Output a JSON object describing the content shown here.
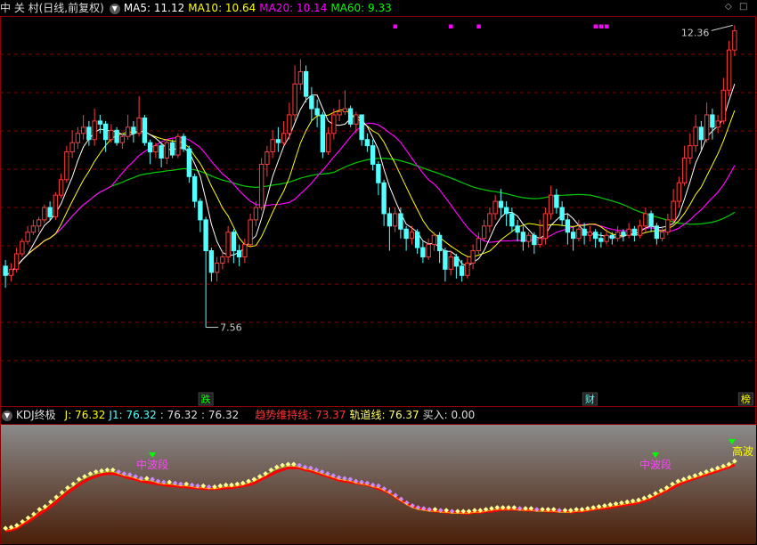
{
  "header": {
    "stock_title": "中 关 村(日线,前复权)",
    "ma": [
      {
        "label": "MA5: 11.12",
        "color": "#ffffff"
      },
      {
        "label": "MA10: 10.64",
        "color": "#ffff00"
      },
      {
        "label": "MA20: 10.14",
        "color": "#ff00ff"
      },
      {
        "label": "MA60: 9.33",
        "color": "#00ff00"
      }
    ]
  },
  "kdj_header": {
    "name": "KDJ终极",
    "j": "J: 76.32",
    "j1": "J1: 76.32",
    "v3": ": 76.32",
    "v4": ": 76.32",
    "trend": "趋势维持线: 73.37",
    "track": "轨道线: 76.37",
    "buy": "买入: 0.00"
  },
  "icons": [
    "dropdown-icon",
    "diamond-icon",
    "square-icon"
  ],
  "colors": {
    "up": "#ff3b3b",
    "down": "#54ffff",
    "ma5": "#ffffff",
    "ma10": "#ffff00",
    "ma20": "#ff00ff",
    "ma60": "#00cc00",
    "grid": "#8b0000"
  },
  "chart_data": [
    {
      "type": "candlestick",
      "title": "中关村 日线 前复权",
      "ylim": [
        6.4,
        12.6
      ],
      "annotations": {
        "high": "12.36",
        "low": "7.56",
        "markers": [
          "跌",
          "财",
          "榜"
        ]
      },
      "candles": [
        [
          8.55,
          8.4,
          8.65,
          8.2
        ],
        [
          8.4,
          8.5,
          8.6,
          8.3
        ],
        [
          8.5,
          8.75,
          8.85,
          8.45
        ],
        [
          8.75,
          8.95,
          9.0,
          8.7
        ],
        [
          8.95,
          9.1,
          9.2,
          8.9
        ],
        [
          9.1,
          9.2,
          9.3,
          9.05
        ],
        [
          9.2,
          9.3,
          9.35,
          9.1
        ],
        [
          9.3,
          9.5,
          9.55,
          9.25
        ],
        [
          9.5,
          9.35,
          9.6,
          9.3
        ],
        [
          9.35,
          9.7,
          9.75,
          9.3
        ],
        [
          9.7,
          9.95,
          10.05,
          9.65
        ],
        [
          9.95,
          10.4,
          10.5,
          9.9
        ],
        [
          10.4,
          10.55,
          10.75,
          10.3
        ],
        [
          10.55,
          10.7,
          10.8,
          10.45
        ],
        [
          10.7,
          10.8,
          11.0,
          10.6
        ],
        [
          10.8,
          10.6,
          10.9,
          10.5
        ],
        [
          10.6,
          10.9,
          11.1,
          10.5
        ],
        [
          10.9,
          10.85,
          11.0,
          10.7
        ],
        [
          10.85,
          10.6,
          10.9,
          10.4
        ],
        [
          10.6,
          10.75,
          10.85,
          10.55
        ],
        [
          10.75,
          10.55,
          10.8,
          10.5
        ],
        [
          10.55,
          10.65,
          10.7,
          10.45
        ],
        [
          10.65,
          10.8,
          11.0,
          10.6
        ],
        [
          10.8,
          10.7,
          10.9,
          10.55
        ],
        [
          10.7,
          10.95,
          11.3,
          10.65
        ],
        [
          10.95,
          10.55,
          11.0,
          10.5
        ],
        [
          10.55,
          10.4,
          10.6,
          10.2
        ],
        [
          10.4,
          10.5,
          10.55,
          10.3
        ],
        [
          10.5,
          10.3,
          10.55,
          10.15
        ],
        [
          10.3,
          10.55,
          10.6,
          10.2
        ],
        [
          10.55,
          10.35,
          10.6,
          10.3
        ],
        [
          10.35,
          10.65,
          10.7,
          10.3
        ],
        [
          10.65,
          10.45,
          10.7,
          10.4
        ],
        [
          10.45,
          10.0,
          10.5,
          9.9
        ],
        [
          10.0,
          9.6,
          10.05,
          9.5
        ],
        [
          9.6,
          9.3,
          9.65,
          9.1
        ],
        [
          9.3,
          8.8,
          9.35,
          7.56
        ],
        [
          8.8,
          8.45,
          8.85,
          8.3
        ],
        [
          8.45,
          8.6,
          8.7,
          8.3
        ],
        [
          8.6,
          8.7,
          8.8,
          8.5
        ],
        [
          8.7,
          9.1,
          9.2,
          8.6
        ],
        [
          9.1,
          8.8,
          9.15,
          8.6
        ],
        [
          8.8,
          8.7,
          8.9,
          8.55
        ],
        [
          8.7,
          8.9,
          9.0,
          8.6
        ],
        [
          8.9,
          9.3,
          9.4,
          8.85
        ],
        [
          9.3,
          9.5,
          9.6,
          9.2
        ],
        [
          9.5,
          10.2,
          10.3,
          9.45
        ],
        [
          10.2,
          10.4,
          10.5,
          10.0
        ],
        [
          10.4,
          10.6,
          10.75,
          10.3
        ],
        [
          10.6,
          10.55,
          10.8,
          10.4
        ],
        [
          10.55,
          10.7,
          10.9,
          10.5
        ],
        [
          10.7,
          11.0,
          11.2,
          10.6
        ],
        [
          11.0,
          11.5,
          11.8,
          10.9
        ],
        [
          11.5,
          11.7,
          11.9,
          11.4
        ],
        [
          11.7,
          11.3,
          11.8,
          11.2
        ],
        [
          11.3,
          11.1,
          11.45,
          10.9
        ],
        [
          11.1,
          11.0,
          11.25,
          10.8
        ],
        [
          11.0,
          10.4,
          11.05,
          10.3
        ],
        [
          10.4,
          10.7,
          10.8,
          10.35
        ],
        [
          10.7,
          11.0,
          11.1,
          10.6
        ],
        [
          11.0,
          11.05,
          11.25,
          10.9
        ],
        [
          11.05,
          11.1,
          11.4,
          11.0
        ],
        [
          11.1,
          10.85,
          11.15,
          10.8
        ],
        [
          10.85,
          11.0,
          11.05,
          10.7
        ],
        [
          11.0,
          10.6,
          11.0,
          10.5
        ],
        [
          10.6,
          10.5,
          10.7,
          10.4
        ],
        [
          10.5,
          10.2,
          10.6,
          10.1
        ],
        [
          10.2,
          9.9,
          10.25,
          9.7
        ],
        [
          9.9,
          9.4,
          9.95,
          9.2
        ],
        [
          9.4,
          9.2,
          9.5,
          8.8
        ],
        [
          9.2,
          9.4,
          9.5,
          9.1
        ],
        [
          9.4,
          9.15,
          9.5,
          9.0
        ],
        [
          9.15,
          9.0,
          9.2,
          8.8
        ],
        [
          9.0,
          9.1,
          9.2,
          8.9
        ],
        [
          9.1,
          8.85,
          9.15,
          8.75
        ],
        [
          8.85,
          8.7,
          8.95,
          8.6
        ],
        [
          8.7,
          8.9,
          9.0,
          8.65
        ],
        [
          8.9,
          9.05,
          9.1,
          8.8
        ],
        [
          9.05,
          8.8,
          9.1,
          8.6
        ],
        [
          8.8,
          8.5,
          8.85,
          8.3
        ],
        [
          8.5,
          8.7,
          8.8,
          8.4
        ],
        [
          8.7,
          8.55,
          8.75,
          8.35
        ],
        [
          8.55,
          8.4,
          8.65,
          8.3
        ],
        [
          8.4,
          8.6,
          8.7,
          8.35
        ],
        [
          8.6,
          8.8,
          8.9,
          8.5
        ],
        [
          8.8,
          9.0,
          9.1,
          8.75
        ],
        [
          9.0,
          9.2,
          9.3,
          8.95
        ],
        [
          9.2,
          9.4,
          9.5,
          9.1
        ],
        [
          9.4,
          9.6,
          9.7,
          9.3
        ],
        [
          9.6,
          9.5,
          9.8,
          9.35
        ],
        [
          9.5,
          9.4,
          9.6,
          9.2
        ],
        [
          9.4,
          9.2,
          9.5,
          9.1
        ],
        [
          9.2,
          9.1,
          9.3,
          8.95
        ],
        [
          9.1,
          8.95,
          9.2,
          8.8
        ],
        [
          8.95,
          9.05,
          9.1,
          8.85
        ],
        [
          9.05,
          8.9,
          9.1,
          8.75
        ],
        [
          8.9,
          9.0,
          9.3,
          8.85
        ],
        [
          9.0,
          9.4,
          9.5,
          8.9
        ],
        [
          9.4,
          9.7,
          9.85,
          9.3
        ],
        [
          9.7,
          9.5,
          9.8,
          9.4
        ],
        [
          9.5,
          9.3,
          9.6,
          9.2
        ],
        [
          9.3,
          9.1,
          9.4,
          8.9
        ],
        [
          9.1,
          9.0,
          9.2,
          8.8
        ],
        [
          9.0,
          9.15,
          9.3,
          8.95
        ],
        [
          9.15,
          9.05,
          9.25,
          8.9
        ],
        [
          9.05,
          9.1,
          9.2,
          8.95
        ],
        [
          9.1,
          9.0,
          9.15,
          8.85
        ],
        [
          9.0,
          8.95,
          9.1,
          8.85
        ],
        [
          8.95,
          9.05,
          9.15,
          8.9
        ],
        [
          9.05,
          9.0,
          9.1,
          8.9
        ],
        [
          9.0,
          9.1,
          9.2,
          8.95
        ],
        [
          9.1,
          9.05,
          9.15,
          8.95
        ],
        [
          9.05,
          9.15,
          9.25,
          9.0
        ],
        [
          9.15,
          9.05,
          9.2,
          8.95
        ],
        [
          9.05,
          9.2,
          9.3,
          9.0
        ],
        [
          9.2,
          9.4,
          9.5,
          9.1
        ],
        [
          9.4,
          9.2,
          9.45,
          9.1
        ],
        [
          9.2,
          9.0,
          9.25,
          8.9
        ],
        [
          9.0,
          9.1,
          9.2,
          8.95
        ],
        [
          9.1,
          9.3,
          9.4,
          9.05
        ],
        [
          9.3,
          9.6,
          9.8,
          9.25
        ],
        [
          9.6,
          9.9,
          10.0,
          9.5
        ],
        [
          9.9,
          10.3,
          10.5,
          9.85
        ],
        [
          10.3,
          10.5,
          10.7,
          10.2
        ],
        [
          10.5,
          10.8,
          11.0,
          10.4
        ],
        [
          10.8,
          10.6,
          10.9,
          10.4
        ],
        [
          10.6,
          11.0,
          11.2,
          10.55
        ],
        [
          11.0,
          10.8,
          11.1,
          10.6
        ],
        [
          10.8,
          10.9,
          11.0,
          10.7
        ],
        [
          10.9,
          11.4,
          11.6,
          10.85
        ],
        [
          11.4,
          12.05,
          12.2,
          11.3
        ],
        [
          12.05,
          12.36,
          12.45,
          11.95
        ]
      ]
    },
    {
      "type": "line",
      "title": "KDJ终极",
      "ylim": [
        -10,
        115
      ],
      "series": [
        {
          "name": "J",
          "color": "#ffff00",
          "values": [
            5,
            6,
            8,
            12,
            16,
            20,
            25,
            28,
            33,
            38,
            43,
            48,
            52,
            57,
            60,
            63,
            65,
            66,
            67,
            67,
            65,
            63,
            62,
            60,
            58,
            58,
            57,
            55,
            54,
            54,
            53,
            52,
            52,
            51,
            50,
            50,
            49,
            49,
            50,
            51,
            51,
            52,
            53,
            55,
            57,
            60,
            63,
            67,
            70,
            72,
            73,
            73,
            72,
            70,
            69,
            67,
            65,
            63,
            61,
            59,
            58,
            57,
            55,
            54,
            53,
            51,
            50,
            47,
            44,
            40,
            36,
            32,
            29,
            27,
            26,
            25,
            25,
            24,
            24,
            23,
            23,
            23,
            23,
            24,
            24,
            25,
            26,
            27,
            27,
            27,
            27,
            26,
            26,
            26,
            25,
            25,
            25,
            25,
            24,
            24,
            24,
            25,
            25,
            26,
            27,
            28,
            29,
            30,
            31,
            32,
            33,
            34,
            35,
            37,
            39,
            42,
            45,
            48,
            52,
            55,
            57,
            59,
            61,
            63,
            65,
            67,
            69,
            71,
            73,
            76.32
          ]
        },
        {
          "name": "J1",
          "color": "#54ffff",
          "values": [
            4,
            5,
            7,
            11,
            15,
            19,
            24,
            27,
            32,
            37,
            42,
            47,
            51,
            56,
            59,
            62,
            64,
            65,
            66,
            66,
            64,
            62,
            61,
            59,
            57,
            57,
            56,
            54,
            53,
            53,
            52,
            51,
            51,
            50,
            49,
            49,
            48,
            48,
            49,
            50,
            50,
            51,
            52,
            54,
            56,
            59,
            62,
            66,
            69,
            71,
            72,
            72,
            71,
            69,
            68,
            66,
            64,
            62,
            60,
            58,
            57,
            56,
            54,
            53,
            52,
            50,
            49,
            46,
            43,
            39,
            35,
            31,
            28,
            26,
            25,
            24,
            24,
            23,
            23,
            22,
            22,
            22,
            22,
            23,
            23,
            24,
            25,
            26,
            26,
            26,
            26,
            25,
            25,
            25,
            24,
            24,
            24,
            24,
            23,
            23,
            23,
            24,
            24,
            25,
            26,
            27,
            28,
            29,
            30,
            31,
            32,
            33,
            34,
            36,
            38,
            41,
            44,
            47,
            51,
            54,
            56,
            58,
            60,
            62,
            64,
            66,
            68,
            70,
            72,
            76.32
          ]
        },
        {
          "name": "趋势维持线",
          "color": "#ff0000",
          "values": [
            3,
            4,
            6,
            10,
            13,
            17,
            21,
            25,
            29,
            34,
            39,
            44,
            48,
            52,
            56,
            59,
            61,
            63,
            64,
            64,
            63,
            61,
            59,
            58,
            56,
            55,
            54,
            53,
            52,
            51,
            51,
            50,
            50,
            49,
            49,
            48,
            48,
            48,
            48,
            49,
            49,
            50,
            51,
            52,
            54,
            57,
            60,
            63,
            66,
            68,
            70,
            70,
            70,
            68,
            67,
            65,
            63,
            61,
            59,
            57,
            56,
            55,
            54,
            53,
            52,
            50,
            48,
            46,
            43,
            39,
            35,
            32,
            29,
            27,
            26,
            25,
            24,
            24,
            23,
            23,
            23,
            22,
            22,
            23,
            23,
            24,
            24,
            25,
            26,
            26,
            26,
            26,
            25,
            25,
            25,
            25,
            24,
            24,
            24,
            24,
            23,
            24,
            24,
            25,
            26,
            27,
            27,
            28,
            29,
            30,
            31,
            32,
            33,
            35,
            37,
            40,
            43,
            46,
            49,
            52,
            55,
            57,
            59,
            61,
            63,
            65,
            67,
            69,
            71,
            73.37
          ]
        }
      ],
      "labels": [
        "中波段",
        "中波段",
        "高波"
      ]
    }
  ]
}
